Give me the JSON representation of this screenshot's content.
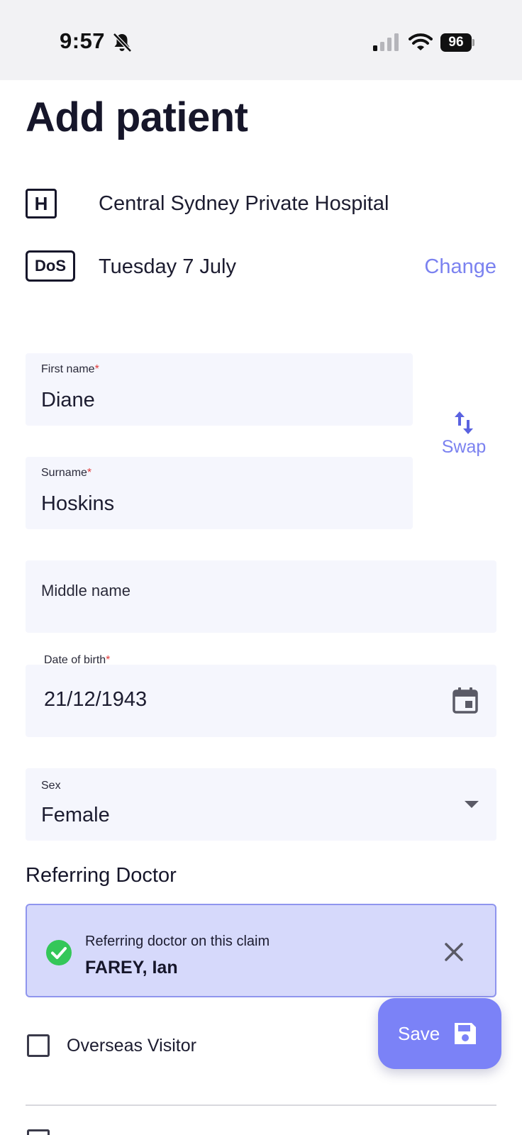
{
  "status_bar": {
    "time": "9:57",
    "battery": "96",
    "icons": [
      "bell-muted-icon",
      "signal-icon",
      "wifi-icon",
      "battery-icon"
    ]
  },
  "page": {
    "title": "Add patient"
  },
  "hospital": {
    "badge": "H",
    "name": "Central Sydney Private Hospital"
  },
  "date_of_service": {
    "badge": "DoS",
    "date": "Tuesday 7 July",
    "change_label": "Change"
  },
  "fields": {
    "first_name": {
      "label": "First name",
      "required_mark": "*",
      "value": "Diane"
    },
    "surname": {
      "label": "Surname",
      "required_mark": "*",
      "value": "Hoskins"
    },
    "middle_name": {
      "placeholder": "Middle name",
      "value": ""
    },
    "dob": {
      "label": "Date of birth",
      "required_mark": "*",
      "value": "21/12/1943"
    },
    "sex": {
      "label": "Sex",
      "value": "Female"
    }
  },
  "swap": {
    "label": "Swap"
  },
  "referring_doctor": {
    "heading": "Referring Doctor",
    "caption": "Referring doctor on this claim",
    "name": "FAREY, Ian"
  },
  "overseas_visitor": {
    "label": "Overseas Visitor",
    "checked": false
  },
  "save_button": {
    "label": "Save"
  },
  "colors": {
    "accent": "#7b82f7",
    "link": "#7b82f0",
    "field_bg": "#f5f6fd",
    "card_bg": "#d6d9fb",
    "success": "#34c759",
    "required": "#e03a3a"
  }
}
